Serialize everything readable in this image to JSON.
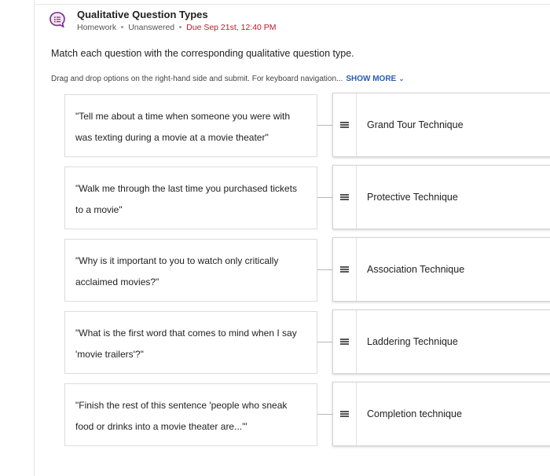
{
  "assignment": {
    "title": "Qualitative Question Types",
    "type": "Homework",
    "status": "Unanswered",
    "due": "Due Sep 21st, 12:40 PM"
  },
  "instruction": "Match each question with the corresponding qualitative question type.",
  "helper": {
    "text": "Drag and drop options on the right-hand side and submit. For keyboard navigation...",
    "show_more": "SHOW MORE"
  },
  "rows": [
    {
      "question": "\"Tell me about a time when someone you were with was texting during a movie at a movie theater\"",
      "answer": "Grand Tour Technique"
    },
    {
      "question": "\"Walk me through the last time you purchased tickets to a movie\"",
      "answer": "Protective Technique"
    },
    {
      "question": "\"Why is it important to you to watch only critically acclaimed movies?\"",
      "answer": "Association Technique"
    },
    {
      "question": "\"What is the first word that comes to mind when I say 'movie trailers'?\"",
      "answer": "Laddering Technique"
    },
    {
      "question": "\"Finish the rest of this sentence 'people who sneak food or drinks into a movie theater are...'\"",
      "answer": "Completion technique"
    }
  ],
  "colors": {
    "accent_purple": "#7a2c8c",
    "due_red": "#c2172a",
    "link_blue": "#2a5db0"
  }
}
